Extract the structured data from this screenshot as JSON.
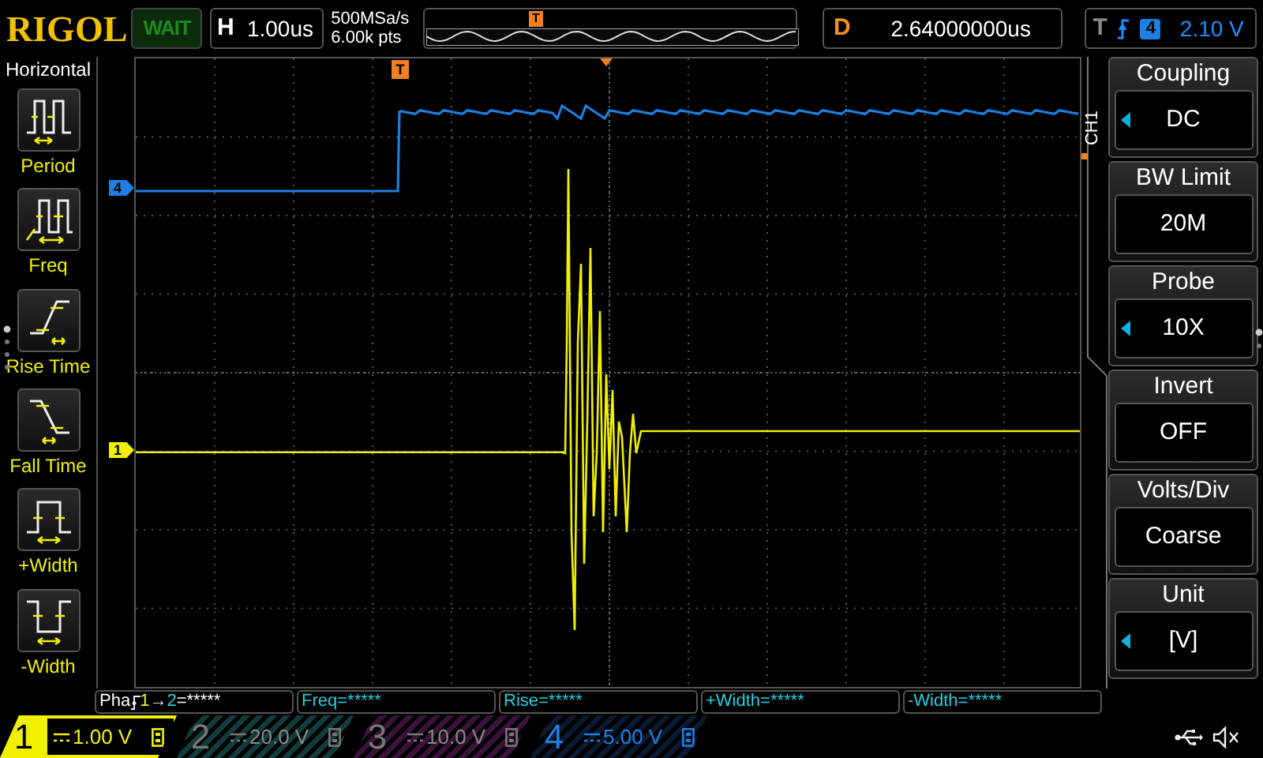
{
  "header": {
    "logo": "RIGOL",
    "run_status": "WAIT",
    "timebase": {
      "label": "H",
      "value": "1.00us"
    },
    "sample_rate": "500MSa/s",
    "memory_depth": "6.00k pts",
    "trigger_marker": "T",
    "delay": {
      "label": "D",
      "value": "2.64000000us"
    },
    "trigger": {
      "label": "T",
      "source": "4",
      "level": "2.10 V"
    }
  },
  "measure_menu": {
    "title": "Horizontal",
    "items": [
      {
        "kind": "period",
        "label": "Period"
      },
      {
        "kind": "freq",
        "label": "Freq"
      },
      {
        "kind": "rise",
        "label": "Rise Time"
      },
      {
        "kind": "fall",
        "label": "Fall Time"
      },
      {
        "kind": "pwidth",
        "label": "+Width"
      },
      {
        "kind": "nwidth",
        "label": "-Width"
      }
    ]
  },
  "plot": {
    "trigger_marker": "T",
    "channel_markers": [
      {
        "label": "4",
        "color": "#1e7fe0"
      },
      {
        "label": "1",
        "color": "#f0f000"
      }
    ]
  },
  "channel_menu": {
    "tab": "CH1",
    "items": [
      {
        "title": "Coupling",
        "value": "DC",
        "arrow": true
      },
      {
        "title": "BW Limit",
        "value": "20M",
        "arrow": false
      },
      {
        "title": "Probe",
        "value": "10X",
        "arrow": true
      },
      {
        "title": "Invert",
        "value": "OFF",
        "arrow": false
      },
      {
        "title": "Volts/Div",
        "value": "Coarse",
        "arrow": false
      },
      {
        "title": "Unit",
        "value": "[V]",
        "arrow": true
      }
    ]
  },
  "measurements": [
    {
      "kind": "phase",
      "prefix": "Pha",
      "from": "1",
      "arrow": "→",
      "to": "2",
      "value": "=*****"
    },
    {
      "kind": "plain",
      "text": "Freq=*****"
    },
    {
      "kind": "plain",
      "text": "Rise=*****"
    },
    {
      "kind": "plain",
      "text": "+Width=*****"
    },
    {
      "kind": "plain",
      "text": "-Width=*****"
    }
  ],
  "channels": [
    {
      "label": "1",
      "scale": "1.00 V",
      "selected": true,
      "on": true,
      "color": "#f0f000"
    },
    {
      "label": "2",
      "scale": "20.0 V",
      "selected": false,
      "on": false,
      "color": "#123c3c"
    },
    {
      "label": "3",
      "scale": "10.0 V",
      "selected": false,
      "on": false,
      "color": "#3c123c"
    },
    {
      "label": "4",
      "scale": "5.00 V",
      "selected": false,
      "on": true,
      "color": "#1e7fe0"
    }
  ]
}
